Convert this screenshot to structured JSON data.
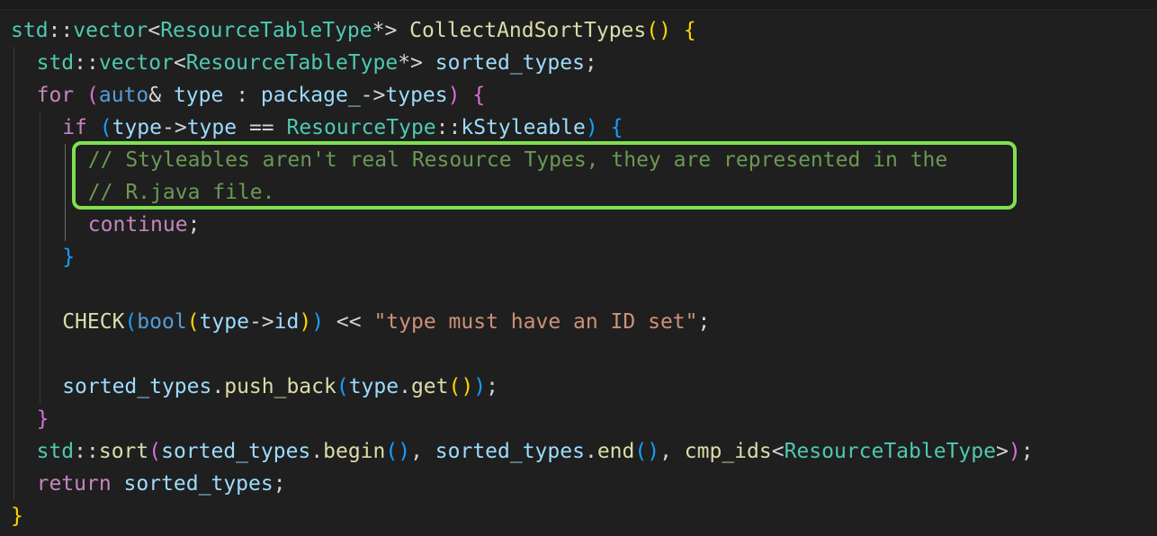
{
  "editor": {
    "language": "cpp",
    "highlight_color": "#7ee14f",
    "lines": [
      {
        "indent": 0,
        "tokens": [
          {
            "t": "std",
            "c": "t-ns"
          },
          {
            "t": "::",
            "c": "t-op"
          },
          {
            "t": "vector",
            "c": "t-ns"
          },
          {
            "t": "<",
            "c": "t-op"
          },
          {
            "t": "ResourceTableType",
            "c": "t-type"
          },
          {
            "t": "*> ",
            "c": "t-op"
          },
          {
            "t": "CollectAndSortTypes",
            "c": "t-fn"
          },
          {
            "t": "()",
            "c": "b1"
          },
          {
            "t": " ",
            "c": "t-op"
          },
          {
            "t": "{",
            "c": "b1"
          }
        ]
      },
      {
        "indent": 1,
        "tokens": [
          {
            "t": "std",
            "c": "t-ns"
          },
          {
            "t": "::",
            "c": "t-op"
          },
          {
            "t": "vector",
            "c": "t-ns"
          },
          {
            "t": "<",
            "c": "t-op"
          },
          {
            "t": "ResourceTableType",
            "c": "t-type"
          },
          {
            "t": "*> ",
            "c": "t-op"
          },
          {
            "t": "sorted_types",
            "c": "t-var"
          },
          {
            "t": ";",
            "c": "t-op"
          }
        ]
      },
      {
        "indent": 1,
        "tokens": [
          {
            "t": "for",
            "c": "t-kw"
          },
          {
            "t": " ",
            "c": "t-op"
          },
          {
            "t": "(",
            "c": "b2"
          },
          {
            "t": "auto",
            "c": "t-kw2"
          },
          {
            "t": "& ",
            "c": "t-op"
          },
          {
            "t": "type",
            "c": "t-var"
          },
          {
            "t": " : ",
            "c": "t-op"
          },
          {
            "t": "package_",
            "c": "t-var"
          },
          {
            "t": "->",
            "c": "t-op"
          },
          {
            "t": "types",
            "c": "t-var"
          },
          {
            "t": ")",
            "c": "b2"
          },
          {
            "t": " ",
            "c": "t-op"
          },
          {
            "t": "{",
            "c": "b2"
          }
        ]
      },
      {
        "indent": 2,
        "tokens": [
          {
            "t": "if",
            "c": "t-kw"
          },
          {
            "t": " ",
            "c": "t-op"
          },
          {
            "t": "(",
            "c": "b3"
          },
          {
            "t": "type",
            "c": "t-var"
          },
          {
            "t": "->",
            "c": "t-op"
          },
          {
            "t": "type",
            "c": "t-var"
          },
          {
            "t": " == ",
            "c": "t-op"
          },
          {
            "t": "ResourceType",
            "c": "t-type"
          },
          {
            "t": "::",
            "c": "t-op"
          },
          {
            "t": "kStyleable",
            "c": "t-var"
          },
          {
            "t": ")",
            "c": "b3"
          },
          {
            "t": " ",
            "c": "t-op"
          },
          {
            "t": "{",
            "c": "b3"
          }
        ]
      },
      {
        "indent": 3,
        "tokens": [
          {
            "t": "// Styleables aren't real Resource Types, they are represented in the",
            "c": "t-com"
          }
        ]
      },
      {
        "indent": 3,
        "tokens": [
          {
            "t": "// R.java file.",
            "c": "t-com"
          }
        ]
      },
      {
        "indent": 3,
        "tokens": [
          {
            "t": "continue",
            "c": "t-kw"
          },
          {
            "t": ";",
            "c": "t-op"
          }
        ]
      },
      {
        "indent": 2,
        "tokens": [
          {
            "t": "}",
            "c": "b3"
          }
        ]
      },
      {
        "indent": 2,
        "tokens": []
      },
      {
        "indent": 2,
        "tokens": [
          {
            "t": "CHECK",
            "c": "t-fn"
          },
          {
            "t": "(",
            "c": "b3"
          },
          {
            "t": "bool",
            "c": "t-kw2"
          },
          {
            "t": "(",
            "c": "b1"
          },
          {
            "t": "type",
            "c": "t-var"
          },
          {
            "t": "->",
            "c": "t-op"
          },
          {
            "t": "id",
            "c": "t-var"
          },
          {
            "t": ")",
            "c": "b1"
          },
          {
            "t": ")",
            "c": "b3"
          },
          {
            "t": " << ",
            "c": "t-op"
          },
          {
            "t": "\"type must have an ID set\"",
            "c": "t-str"
          },
          {
            "t": ";",
            "c": "t-op"
          }
        ]
      },
      {
        "indent": 2,
        "tokens": []
      },
      {
        "indent": 2,
        "tokens": [
          {
            "t": "sorted_types",
            "c": "t-var"
          },
          {
            "t": ".",
            "c": "t-op"
          },
          {
            "t": "push_back",
            "c": "t-fn"
          },
          {
            "t": "(",
            "c": "b3"
          },
          {
            "t": "type",
            "c": "t-var"
          },
          {
            "t": ".",
            "c": "t-op"
          },
          {
            "t": "get",
            "c": "t-fn"
          },
          {
            "t": "()",
            "c": "b1"
          },
          {
            "t": ")",
            "c": "b3"
          },
          {
            "t": ";",
            "c": "t-op"
          }
        ]
      },
      {
        "indent": 1,
        "tokens": [
          {
            "t": "}",
            "c": "b2"
          }
        ]
      },
      {
        "indent": 1,
        "tokens": [
          {
            "t": "std",
            "c": "t-ns"
          },
          {
            "t": "::",
            "c": "t-op"
          },
          {
            "t": "sort",
            "c": "t-fn"
          },
          {
            "t": "(",
            "c": "b2"
          },
          {
            "t": "sorted_types",
            "c": "t-var"
          },
          {
            "t": ".",
            "c": "t-op"
          },
          {
            "t": "begin",
            "c": "t-fn"
          },
          {
            "t": "()",
            "c": "b3"
          },
          {
            "t": ", ",
            "c": "t-op"
          },
          {
            "t": "sorted_types",
            "c": "t-var"
          },
          {
            "t": ".",
            "c": "t-op"
          },
          {
            "t": "end",
            "c": "t-fn"
          },
          {
            "t": "()",
            "c": "b3"
          },
          {
            "t": ", ",
            "c": "t-op"
          },
          {
            "t": "cmp_ids",
            "c": "t-fn"
          },
          {
            "t": "<",
            "c": "t-op"
          },
          {
            "t": "ResourceTableType",
            "c": "t-type"
          },
          {
            "t": ">",
            "c": "t-op"
          },
          {
            "t": ")",
            "c": "b2"
          },
          {
            "t": ";",
            "c": "t-op"
          }
        ]
      },
      {
        "indent": 1,
        "tokens": [
          {
            "t": "return",
            "c": "t-kw"
          },
          {
            "t": " ",
            "c": "t-op"
          },
          {
            "t": "sorted_types",
            "c": "t-var"
          },
          {
            "t": ";",
            "c": "t-op"
          }
        ]
      },
      {
        "indent": 0,
        "tokens": [
          {
            "t": "}",
            "c": "b1"
          }
        ]
      }
    ]
  }
}
